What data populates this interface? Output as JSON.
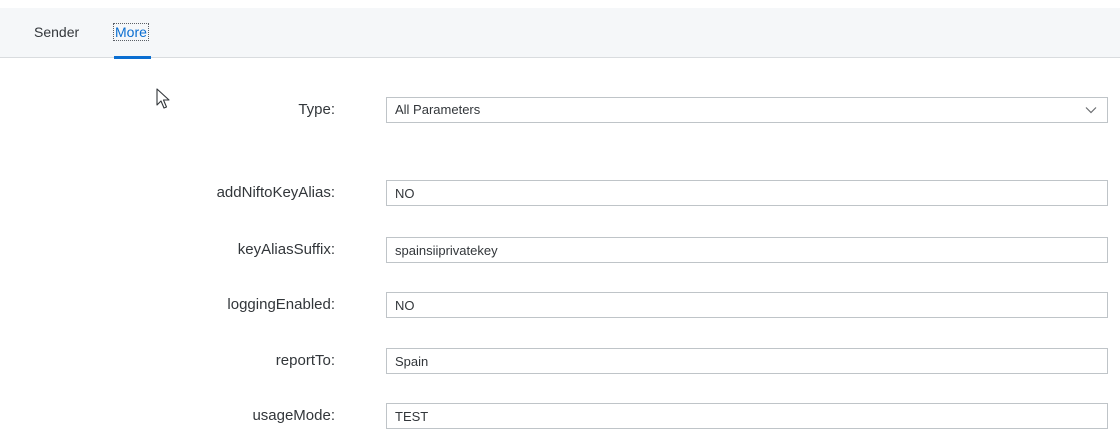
{
  "tabs": [
    {
      "label": "Sender"
    },
    {
      "label": "More"
    }
  ],
  "form": {
    "type": {
      "label": "Type:",
      "value": "All Parameters"
    },
    "params": [
      {
        "label": "addNiftoKeyAlias:",
        "value": "NO"
      },
      {
        "label": "keyAliasSuffix:",
        "value": "spainsiiprivatekey"
      },
      {
        "label": "loggingEnabled:",
        "value": "NO"
      },
      {
        "label": "reportTo:",
        "value": "Spain"
      },
      {
        "label": "usageMode:",
        "value": "TEST"
      }
    ]
  },
  "colors": {
    "accent": "#0a6ed1",
    "tabbar_bg": "#f5f7f9",
    "text": "#32363a",
    "field_border": "#bfc4c8"
  },
  "icons": {
    "dropdown": "chevron-down-icon",
    "cursor": "mouse-pointer-icon"
  }
}
